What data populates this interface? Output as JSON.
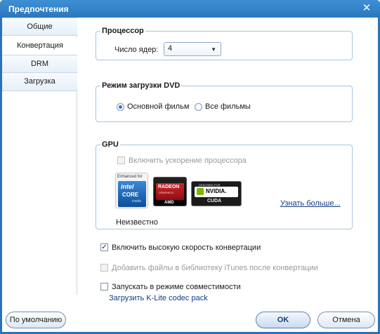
{
  "window": {
    "title": "Предпочтения",
    "close_glyph": "✕"
  },
  "sidebar": {
    "items": [
      {
        "label": "Общие"
      },
      {
        "label": "Конвертация"
      },
      {
        "label": "DRM"
      },
      {
        "label": "Загрузка"
      }
    ],
    "active_index": 1
  },
  "processor": {
    "title": "Процессор",
    "cores_label": "Число ядер:",
    "cores_value": "4"
  },
  "dvd": {
    "title": "Режим загрузки DVD",
    "option_main": "Основной фильм",
    "option_all": "Все фильмы",
    "selected": "main"
  },
  "gpu": {
    "title": "GPU",
    "accel_label": "Включить ускорение процессора",
    "accel_checked": false,
    "learn_more": "Узнать больше...",
    "status": "Неизвестно",
    "logos": [
      {
        "name": "intel",
        "lines": [
          "Enhanced for",
          "intel",
          "CORE",
          "inside"
        ]
      },
      {
        "name": "amd",
        "lines": [
          "RADEON",
          "GRAPHICS",
          "AMD"
        ]
      },
      {
        "name": "nvidia",
        "lines": [
          "DESIGNED FOR",
          "NVIDIA.",
          "CUDA"
        ]
      }
    ]
  },
  "options": {
    "high_speed": {
      "label": "Включить высокую скорость конвертации",
      "checked": true
    },
    "itunes": {
      "label": "Добавить файлы в библиотеку iTunes после конвертации",
      "checked": false,
      "disabled": true
    },
    "compat": {
      "label": "Запускать в режиме совместимости",
      "checked": false
    },
    "codec_link": "Загрузить K-Lite codec pack"
  },
  "buttons": {
    "default": "По умолчанию",
    "ok": "OK",
    "cancel": "Отмена"
  },
  "colors": {
    "title_bar": "#2b77bd",
    "group_border": "#a9c4e0",
    "link": "#123d84"
  }
}
